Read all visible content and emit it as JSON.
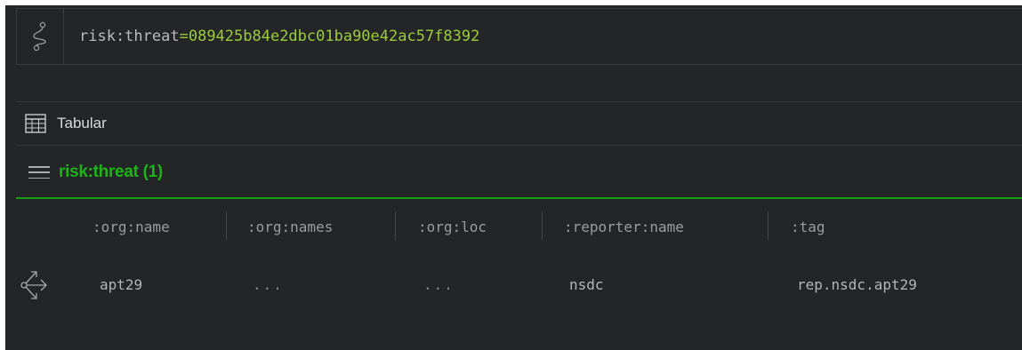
{
  "query": {
    "name": "risk:threat",
    "operator": "=",
    "value": "089425b84e2dbc01ba90e42ac57f8392",
    "icon": "pipeline-icon"
  },
  "view": {
    "label": "Tabular",
    "icon": "table-icon"
  },
  "form_group": {
    "label": "risk:threat (1)",
    "icon": "menu-icon",
    "color": "#1fb31a"
  },
  "table": {
    "columns": [
      ":org:name",
      ":org:names",
      ":org:loc",
      ":reporter:name",
      ":tag"
    ],
    "rows": [
      {
        "icon": "explore-icon",
        "cells": [
          "apt29",
          "...",
          "...",
          "nsdc",
          "rep.nsdc.apt29"
        ]
      }
    ]
  },
  "colors": {
    "background": "#232526",
    "query_value": "#9ccc3c",
    "accent_green": "#1a9d16"
  }
}
